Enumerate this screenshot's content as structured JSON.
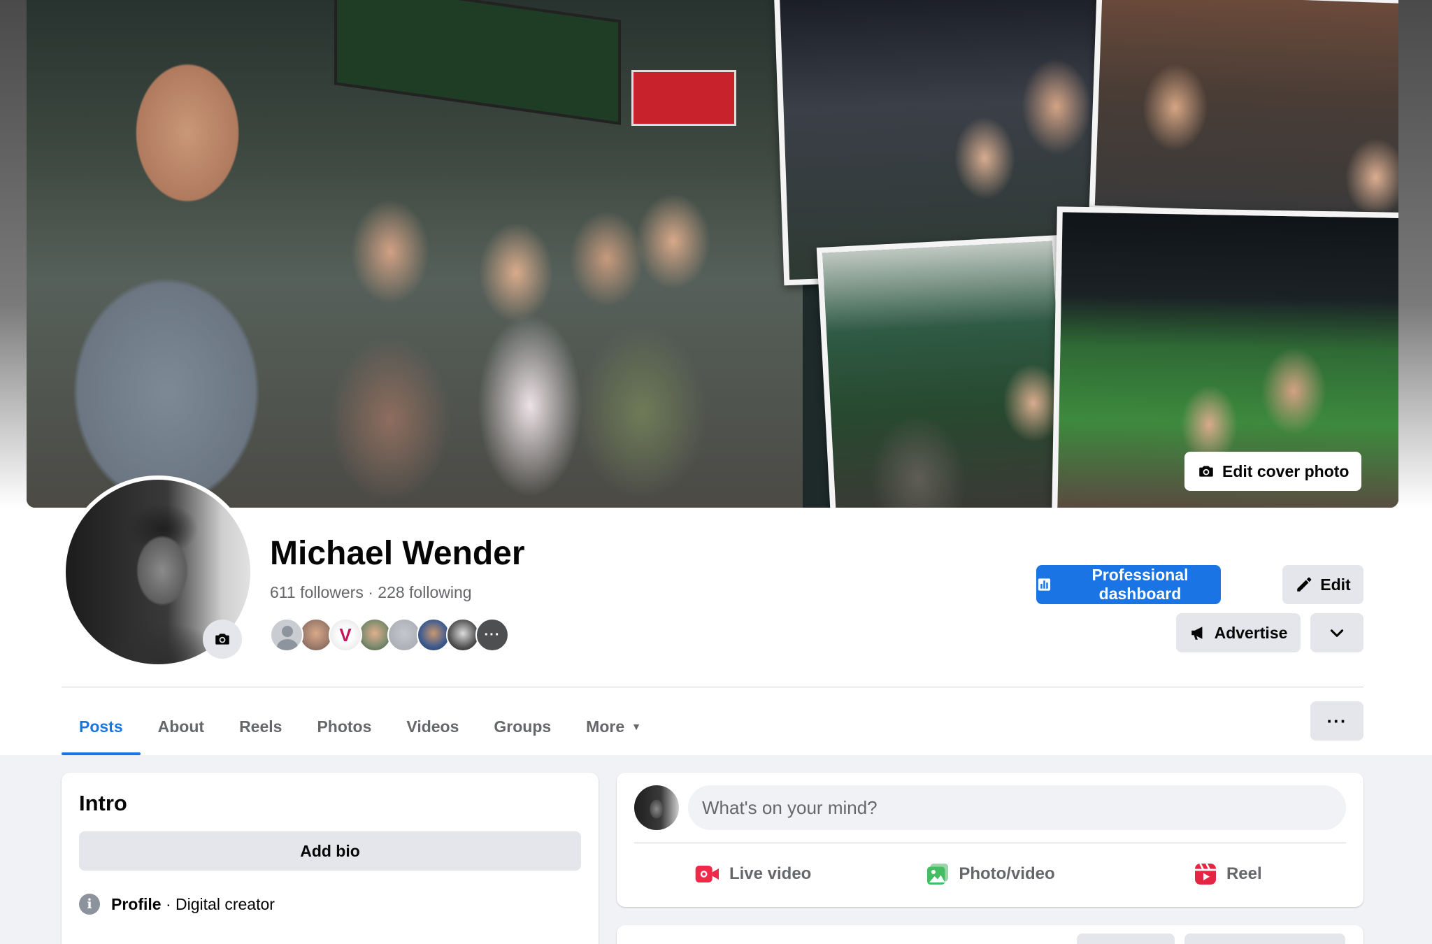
{
  "cover": {
    "edit_cover_label": "Edit cover photo",
    "edit_cover_icon": "camera-icon"
  },
  "profile": {
    "name": "Michael Wender",
    "followers_count": "611",
    "followers_label": "followers",
    "separator": " · ",
    "following_count": "228",
    "following_label": "following",
    "friends_more_glyph": "···",
    "avatar_camera_icon": "camera-icon"
  },
  "actions": {
    "professional_dashboard_label": "Professional dashboard",
    "professional_dashboard_icon": "chart-bars-icon",
    "edit_label": "Edit",
    "edit_icon": "pencil-icon",
    "advertise_label": "Advertise",
    "advertise_icon": "megaphone-icon",
    "chevron_icon": "chevron-down-icon"
  },
  "tabs": {
    "items": [
      {
        "label": "Posts",
        "active": true
      },
      {
        "label": "About",
        "active": false
      },
      {
        "label": "Reels",
        "active": false
      },
      {
        "label": "Photos",
        "active": false
      },
      {
        "label": "Videos",
        "active": false
      },
      {
        "label": "Groups",
        "active": false
      },
      {
        "label": "More",
        "active": false
      }
    ],
    "more_glyph": "▼",
    "overflow_glyph": "···"
  },
  "intro": {
    "title": "Intro",
    "add_bio_label": "Add bio",
    "info_glyph": "i",
    "profile_label": "Profile",
    "profile_category": " · Digital creator"
  },
  "composer": {
    "placeholder": "What's on your mind?",
    "live_video_label": "Live video",
    "photo_video_label": "Photo/video",
    "reel_label": "Reel"
  },
  "colors": {
    "accent": "#1b74e4",
    "live_red": "#f02849",
    "photo_green": "#45bd62",
    "reel_red": "#e42645",
    "secondary_text": "#65676b",
    "button_gray": "#e4e6eb"
  }
}
